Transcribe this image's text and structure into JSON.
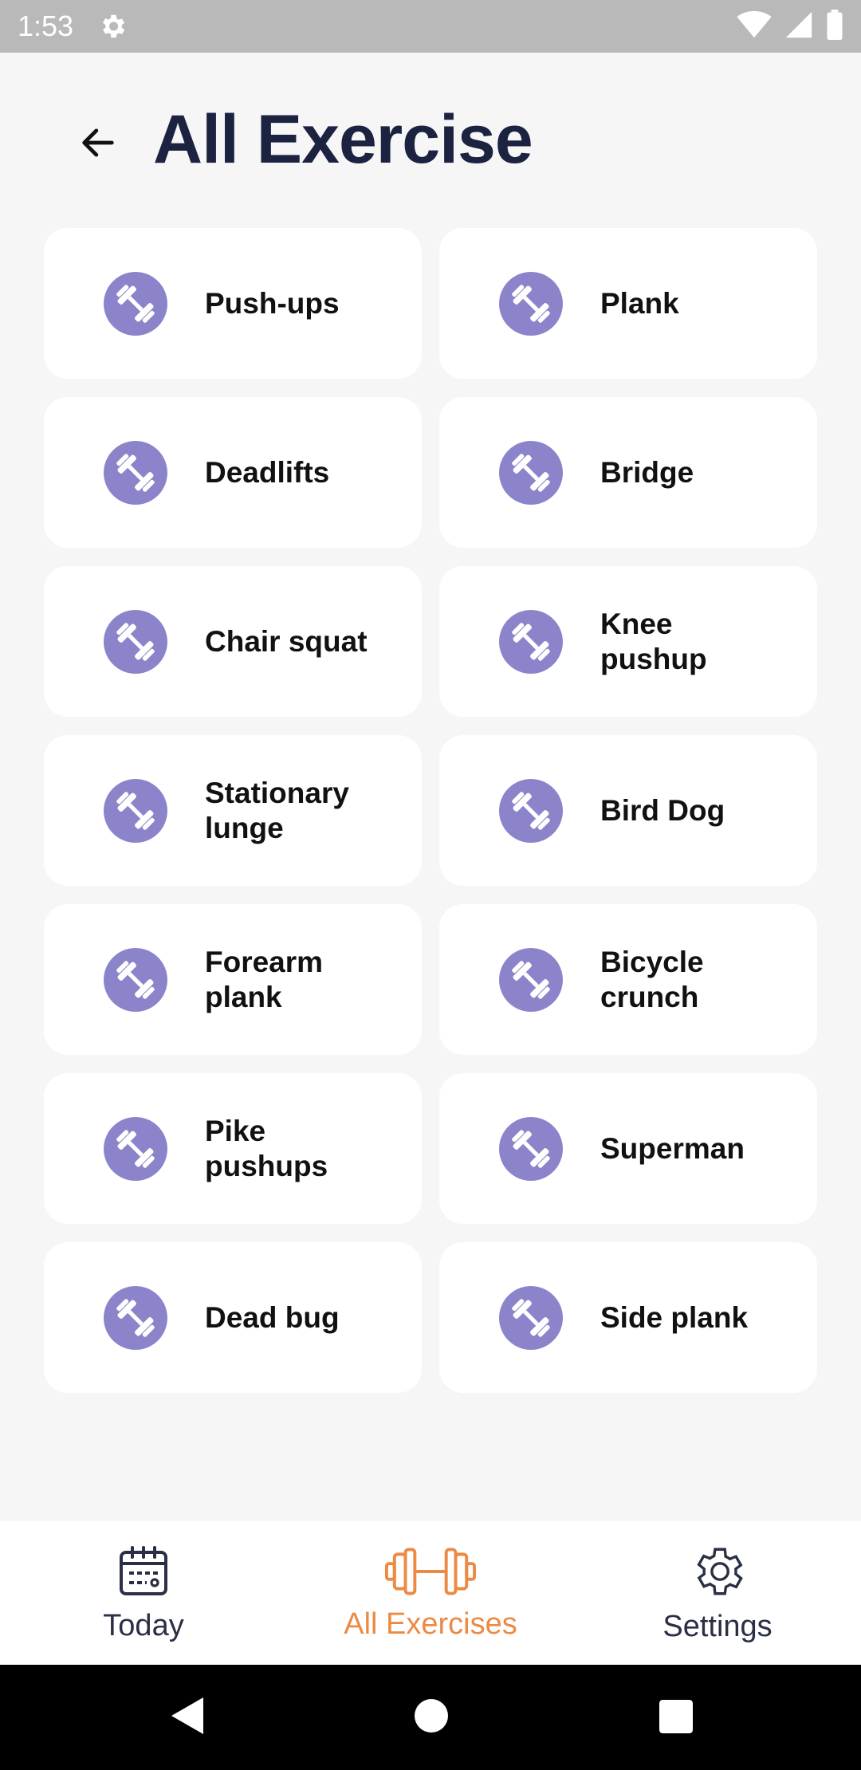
{
  "status_bar": {
    "time": "1:53",
    "icons": [
      "gear-icon",
      "wifi-icon",
      "signal-icon",
      "battery-icon"
    ]
  },
  "header": {
    "title": "All Exercise",
    "back_icon": "arrow-left-icon"
  },
  "exercises": [
    {
      "label": "Push-ups"
    },
    {
      "label": "Plank"
    },
    {
      "label": "Deadlifts"
    },
    {
      "label": "Bridge"
    },
    {
      "label": "Chair squat"
    },
    {
      "label": "Knee pushup"
    },
    {
      "label": "Stationary lunge"
    },
    {
      "label": "Bird Dog"
    },
    {
      "label": "Forearm plank"
    },
    {
      "label": "Bicycle crunch"
    },
    {
      "label": "Pike pushups"
    },
    {
      "label": "Superman"
    },
    {
      "label": "Dead bug"
    },
    {
      "label": "Side plank"
    }
  ],
  "bottom_nav": {
    "items": [
      {
        "label": "Today",
        "icon": "calendar-icon",
        "active": false
      },
      {
        "label": "All Exercises",
        "icon": "dumbbell-icon",
        "active": true
      },
      {
        "label": "Settings",
        "icon": "gear-icon",
        "active": false
      }
    ]
  },
  "colors": {
    "accent": "#ec8a44",
    "icon_circle": "#8c84cb",
    "title": "#1c2340",
    "status_bar": "#b9b9b9"
  }
}
